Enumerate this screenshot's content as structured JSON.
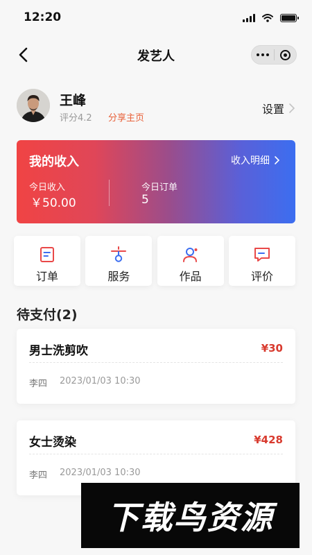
{
  "status": {
    "time": "12:20"
  },
  "nav": {
    "title": "发艺人"
  },
  "profile": {
    "name": "王峰",
    "rating": "评分4.2",
    "share": "分享主页",
    "settings": "设置"
  },
  "income": {
    "title": "我的收入",
    "detail": "收入明细",
    "today_income_label": "今日收入",
    "today_income_value": "￥50.00",
    "today_orders_label": "今日订单",
    "today_orders_value": "5"
  },
  "entries": [
    {
      "label": "订单",
      "icon": "order-icon"
    },
    {
      "label": "服务",
      "icon": "service-icon"
    },
    {
      "label": "作品",
      "icon": "works-icon"
    },
    {
      "label": "评价",
      "icon": "review-icon"
    }
  ],
  "pending": {
    "title": "待支付(2)",
    "orders": [
      {
        "name": "男士洗剪吹",
        "price": "¥30",
        "customer": "李四",
        "time": "2023/01/03 10:30"
      },
      {
        "name": "女士烫染",
        "price": "¥428",
        "customer": "李四",
        "time": "2023/01/03 10:30"
      }
    ]
  },
  "watermark": {
    "text": "下载鸟资源"
  },
  "colors": {
    "accent": "#e8613a",
    "price": "#d83a2e",
    "gradient_start": "#f04444",
    "gradient_end": "#3c6ef0"
  }
}
